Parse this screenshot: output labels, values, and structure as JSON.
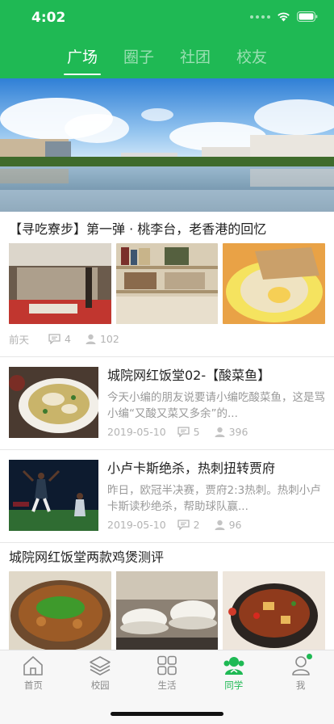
{
  "status_bar": {
    "time": "4:02"
  },
  "tabs": [
    {
      "label": "广场",
      "active": true
    },
    {
      "label": "圈子",
      "active": false
    },
    {
      "label": "社团",
      "active": false
    },
    {
      "label": "校友",
      "active": false
    }
  ],
  "feed": {
    "gallery_post_1": {
      "title": "【寻吃寮步】第一弹 · 桃李台，老香港的回忆",
      "time": "前天",
      "comments": "4",
      "views": "102"
    },
    "row_post_1": {
      "title": "城院网红饭堂02-【酸菜鱼】",
      "excerpt": "今天小编的朋友说要请小编吃酸菜鱼，这是骂小编“又酸又菜又多余”的...",
      "date": "2019-05-10",
      "comments": "5",
      "views": "396"
    },
    "row_post_2": {
      "title": "小卢卡斯绝杀，热刺扭转贾府",
      "excerpt": "昨日，欧冠半决赛，贾府2:3热刺。热刺小卢卡斯读秒绝杀，帮助球队赢...",
      "date": "2019-05-10",
      "comments": "2",
      "views": "96"
    },
    "gallery_post_2": {
      "title": "城院网红饭堂两款鸡煲测评"
    }
  },
  "tabbar": [
    {
      "label": "首页",
      "icon": "home-icon",
      "active": false
    },
    {
      "label": "校园",
      "icon": "layers-icon",
      "active": false
    },
    {
      "label": "生活",
      "icon": "grid-icon",
      "active": false
    },
    {
      "label": "同学",
      "icon": "classmates-icon",
      "active": true
    },
    {
      "label": "我",
      "icon": "profile-icon",
      "active": false,
      "has_badge": true
    }
  ],
  "colors": {
    "brand_green": "#1fb954",
    "meta_gray": "#b3b3b3",
    "text_dark": "#222222"
  }
}
